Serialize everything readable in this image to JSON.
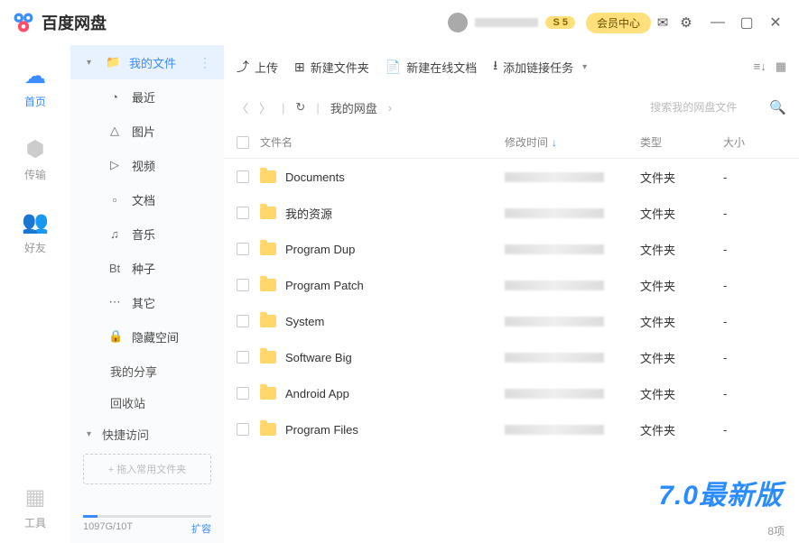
{
  "titlebar": {
    "app_name": "百度网盘",
    "coin_badge": "S 5",
    "vip_label": "会员中心"
  },
  "rail": [
    {
      "label": "首页",
      "icon": "☁",
      "active": true
    },
    {
      "label": "传输",
      "icon": "⬢",
      "active": false
    },
    {
      "label": "好友",
      "icon": "👥",
      "active": false
    }
  ],
  "rail_bottom": {
    "label": "工具",
    "icon": "▦"
  },
  "sidebar": {
    "items": [
      {
        "label": "我的文件",
        "icon": "📁",
        "active": true,
        "has_menu": true
      },
      {
        "label": "最近",
        "icon": "◔"
      },
      {
        "label": "图片",
        "icon": "△"
      },
      {
        "label": "视频",
        "icon": "▷"
      },
      {
        "label": "文档",
        "icon": "▫"
      },
      {
        "label": "音乐",
        "icon": "♫"
      },
      {
        "label": "种子",
        "icon": "Bt"
      },
      {
        "label": "其它",
        "icon": "⋯"
      },
      {
        "label": "隐藏空间",
        "icon": "🔒"
      }
    ],
    "sections": [
      {
        "label": "我的分享"
      },
      {
        "label": "回收站"
      }
    ],
    "quick_access": "快捷访问",
    "drop_hint": "+ 拖入常用文件夹",
    "storage_used": "1097G/10T",
    "storage_expand": "扩容"
  },
  "toolbar": {
    "upload": "上传",
    "new_folder": "新建文件夹",
    "new_online_doc": "新建在线文档",
    "add_link": "添加链接任务"
  },
  "breadcrumb": {
    "root": "我的网盘"
  },
  "search": {
    "placeholder": "搜索我的网盘文件"
  },
  "columns": {
    "name": "文件名",
    "date": "修改时间",
    "type": "类型",
    "size": "大小"
  },
  "files": [
    {
      "name": "Documents",
      "type": "文件夹",
      "size": "-"
    },
    {
      "name": "我的资源",
      "type": "文件夹",
      "size": "-"
    },
    {
      "name": "Program Dup",
      "type": "文件夹",
      "size": "-"
    },
    {
      "name": "Program Patch",
      "type": "文件夹",
      "size": "-"
    },
    {
      "name": "System",
      "type": "文件夹",
      "size": "-"
    },
    {
      "name": "Software Big",
      "type": "文件夹",
      "size": "-"
    },
    {
      "name": "Android App",
      "type": "文件夹",
      "size": "-"
    },
    {
      "name": "Program Files",
      "type": "文件夹",
      "size": "-"
    }
  ],
  "footer": {
    "count": "8项"
  },
  "watermark": "7.0最新版"
}
